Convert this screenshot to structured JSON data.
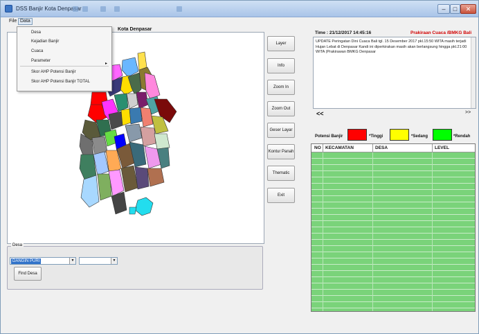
{
  "window": {
    "title": "DSS Banjir Kota Denpasar"
  },
  "menu": {
    "file": "File",
    "data": "Data"
  },
  "data_menu": {
    "items": [
      "Desa",
      "Kejadian Banjir",
      "Cuaca",
      "Parameter",
      "Skor AHP Potensi Banjir",
      "Skor AHP Potensi Banjir TOTAL"
    ],
    "submenu_arrow": "▸"
  },
  "map": {
    "title": "Kota Denpasar"
  },
  "toolbar": [
    "Layer",
    "Info",
    "Zoom In",
    "Zoom Out",
    "Geser Layar",
    "Kontur Panah",
    "Thematic",
    "Exit"
  ],
  "weather": {
    "time_label": "Time : 21/12/2017 14:45:16",
    "forecast_title": "Prakiraan Cuaca /BMKG Bali",
    "update_text": "UPDATE Peringatan Dini Cuaca Bali tgl. 15 Desember 2017 pkl.15:50 WITA masih terjadi Hujan Lebat di Denpasar Kandi ini diperkirakan masih akan berlangsung hingga pkl.21:00 WITA (Prakirawan BMKG Denpasar",
    "nav_prev": "<<",
    "nav_next": ">>"
  },
  "legend": {
    "label": "Potensi Banjir",
    "items": [
      {
        "text": "*Tinggi",
        "color": "#ff0000"
      },
      {
        "text": "*Sedang",
        "color": "#ffff00"
      },
      {
        "text": "*Rendah",
        "color": "#00ff00"
      }
    ]
  },
  "table": {
    "columns": [
      "NO",
      "KECAMATAN",
      "DESA",
      "LEVEL"
    ]
  },
  "desa_panel": {
    "group_label": "Desa",
    "combo1_value": "DANGIN PURI",
    "combo2_value": "",
    "find_button": "Find Desa"
  },
  "colors": {
    "grid_green": "#7ad37a",
    "accent_blue": "#3072c9",
    "forecast_red": "#d10000"
  }
}
